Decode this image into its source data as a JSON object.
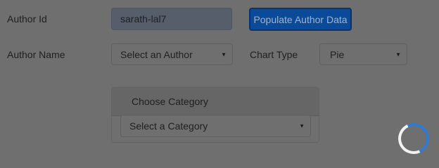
{
  "form": {
    "author_id_label": "Author Id",
    "author_id_value": "sarath-lal7",
    "populate_button": "Populate Author Data",
    "author_name_label": "Author Name",
    "author_select_value": "Select an Author",
    "chart_type_label": "Chart Type",
    "chart_type_value": "Pie"
  },
  "category_panel": {
    "heading": "Choose Category",
    "select_value": "Select a Category"
  },
  "icons": {
    "dropdown": "caret-down-icon",
    "loading": "loading-spinner"
  },
  "colors": {
    "overlay_gray": "#6f6f6f",
    "primary_button": "#0b4a99",
    "spinner_accent": "#2f7bd4"
  }
}
